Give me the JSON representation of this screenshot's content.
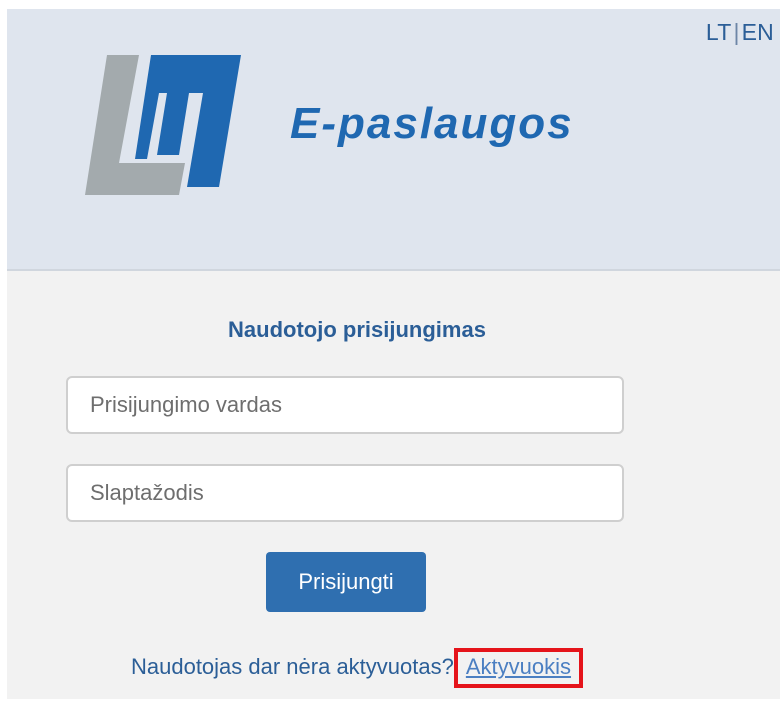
{
  "header": {
    "lang_lt": "LT",
    "lang_separator": "|",
    "lang_en": "EN",
    "brand_title": "E-paslaugos",
    "logo_name": "LM logo",
    "colors": {
      "header_bg": "#dfe5ee",
      "logo_grey": "#a3aaad",
      "logo_blue": "#1f68b1"
    }
  },
  "login": {
    "title": "Naudotojo prisijungimas",
    "username_placeholder": "Prisijungimo vardas",
    "password_placeholder": "Slaptažodis",
    "submit_label": "Prisijungti",
    "not_activated_text": "Naudotojas dar nėra aktyvuotas?",
    "activate_link_label": "Aktyvuokis",
    "colors": {
      "button_bg": "#2f6fb0",
      "highlight_border": "#e5141b",
      "text": "#2b5e97"
    }
  }
}
